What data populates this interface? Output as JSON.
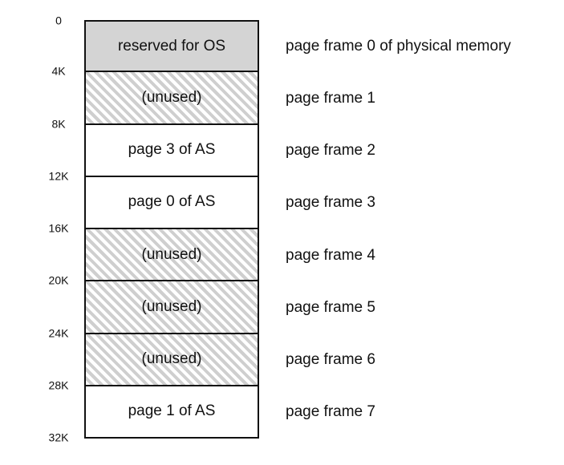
{
  "frames": [
    {
      "content": "reserved for OS",
      "kind": "reserved",
      "label": "page frame 0 of physical memory"
    },
    {
      "content": "(unused)",
      "kind": "unused",
      "label": "page frame 1"
    },
    {
      "content": "page 3 of AS",
      "kind": "used",
      "label": "page frame 2"
    },
    {
      "content": "page 0 of AS",
      "kind": "used",
      "label": "page frame 3"
    },
    {
      "content": "(unused)",
      "kind": "unused",
      "label": "page frame 4"
    },
    {
      "content": "(unused)",
      "kind": "unused",
      "label": "page frame 5"
    },
    {
      "content": "(unused)",
      "kind": "unused",
      "label": "page frame 6"
    },
    {
      "content": "page 1 of AS",
      "kind": "used",
      "label": "page frame 7"
    }
  ],
  "addresses": [
    "0",
    "4K",
    "8K",
    "12K",
    "16K",
    "20K",
    "24K",
    "28K",
    "32K"
  ],
  "colors": {
    "reserved": "#d4d4d4",
    "hatch": "#cfcfcf",
    "border": "#111111"
  }
}
